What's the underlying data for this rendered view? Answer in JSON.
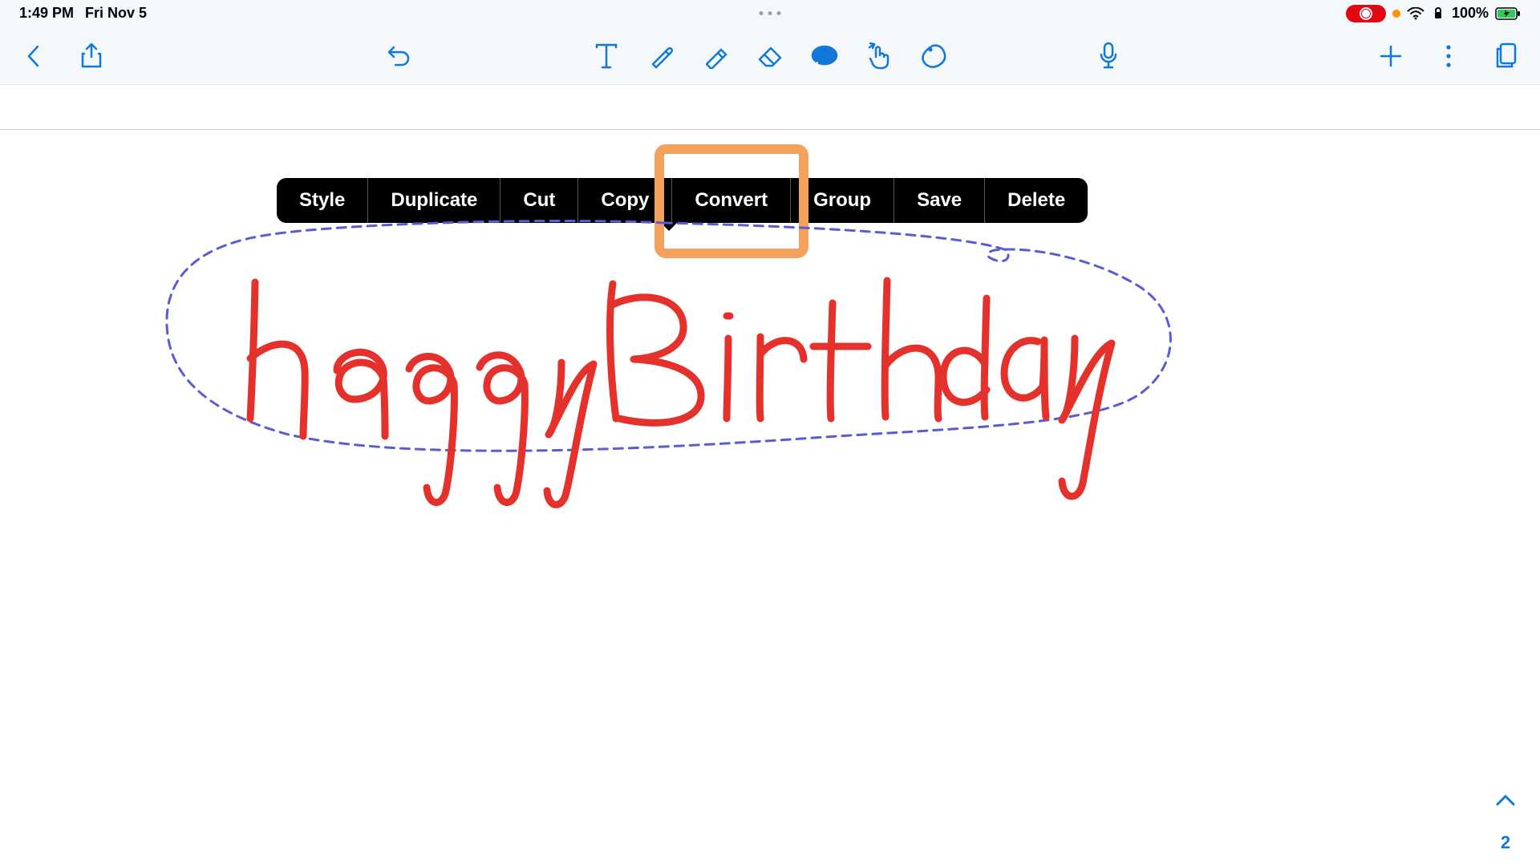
{
  "status": {
    "time": "1:49 PM",
    "date": "Fri Nov 5",
    "battery": "100%"
  },
  "context_menu": {
    "items": [
      "Style",
      "Duplicate",
      "Cut",
      "Copy",
      "Convert",
      "Group",
      "Save",
      "Delete"
    ],
    "highlighted_index": 4
  },
  "handwriting": {
    "text": "Happy Birthday",
    "color": "#e4312b"
  },
  "selection": {
    "stroke": "#5b5bd6"
  },
  "page": {
    "current": "2"
  },
  "toolbar_icons": [
    "text",
    "pencil",
    "highlighter",
    "eraser",
    "lasso",
    "gesture",
    "shape"
  ]
}
